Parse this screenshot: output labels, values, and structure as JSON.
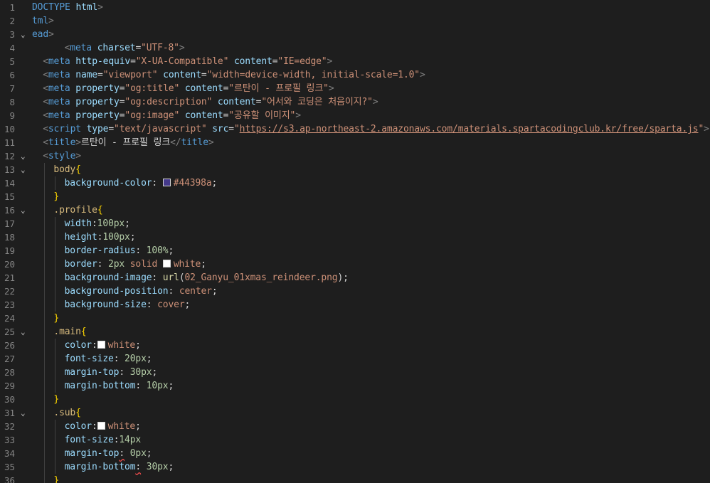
{
  "editor": {
    "lines": [
      {
        "n": "1",
        "fold": "",
        "indent": 0,
        "tokens": [
          [
            "t-tag",
            "DOCTYPE"
          ],
          [
            "t-text",
            " "
          ],
          [
            "t-attr",
            "html"
          ],
          [
            "t-punc",
            ">"
          ]
        ]
      },
      {
        "n": "2",
        "fold": "",
        "indent": 0,
        "tokens": [
          [
            "t-tag",
            "tml"
          ],
          [
            "t-punc",
            ">"
          ]
        ]
      },
      {
        "n": "3",
        "fold": "v",
        "indent": 0,
        "tokens": [
          [
            "t-tag",
            "ead"
          ],
          [
            "t-punc",
            ">"
          ]
        ]
      },
      {
        "n": "4",
        "fold": "",
        "indent": 3,
        "tokens": [
          [
            "t-punc",
            "<"
          ],
          [
            "t-tag",
            "meta"
          ],
          [
            "t-text",
            " "
          ],
          [
            "t-attr",
            "charset"
          ],
          [
            "t-text",
            "="
          ],
          [
            "t-str",
            "\"UTF-8\""
          ],
          [
            "t-punc",
            ">"
          ]
        ]
      },
      {
        "n": "5",
        "fold": "",
        "indent": 1,
        "tokens": [
          [
            "t-punc",
            "<"
          ],
          [
            "t-tag",
            "meta"
          ],
          [
            "t-text",
            " "
          ],
          [
            "t-attr",
            "http-equiv"
          ],
          [
            "t-text",
            "="
          ],
          [
            "t-str",
            "\"X-UA-Compatible\""
          ],
          [
            "t-text",
            " "
          ],
          [
            "t-attr",
            "content"
          ],
          [
            "t-text",
            "="
          ],
          [
            "t-str",
            "\"IE=edge\""
          ],
          [
            "t-punc",
            ">"
          ]
        ]
      },
      {
        "n": "6",
        "fold": "",
        "indent": 1,
        "tokens": [
          [
            "t-punc",
            "<"
          ],
          [
            "t-tag",
            "meta"
          ],
          [
            "t-text",
            " "
          ],
          [
            "t-attr",
            "name"
          ],
          [
            "t-text",
            "="
          ],
          [
            "t-str",
            "\"viewport\""
          ],
          [
            "t-text",
            " "
          ],
          [
            "t-attr",
            "content"
          ],
          [
            "t-text",
            "="
          ],
          [
            "t-str",
            "\"width=device-width, initial-scale=1.0\""
          ],
          [
            "t-punc",
            ">"
          ]
        ]
      },
      {
        "n": "7",
        "fold": "",
        "indent": 1,
        "tokens": [
          [
            "t-punc",
            "<"
          ],
          [
            "t-tag",
            "meta"
          ],
          [
            "t-text",
            " "
          ],
          [
            "t-attr",
            "property"
          ],
          [
            "t-text",
            "="
          ],
          [
            "t-str",
            "\"og:title\""
          ],
          [
            "t-text",
            " "
          ],
          [
            "t-attr",
            "content"
          ],
          [
            "t-text",
            "="
          ],
          [
            "t-str",
            "\"르탄이 - 프로필 링크\""
          ],
          [
            "t-punc",
            ">"
          ]
        ]
      },
      {
        "n": "8",
        "fold": "",
        "indent": 1,
        "tokens": [
          [
            "t-punc",
            "<"
          ],
          [
            "t-tag",
            "meta"
          ],
          [
            "t-text",
            " "
          ],
          [
            "t-attr",
            "property"
          ],
          [
            "t-text",
            "="
          ],
          [
            "t-str",
            "\"og:description\""
          ],
          [
            "t-text",
            " "
          ],
          [
            "t-attr",
            "content"
          ],
          [
            "t-text",
            "="
          ],
          [
            "t-str",
            "\"어서와 코딩은 처음이지?\""
          ],
          [
            "t-punc",
            ">"
          ]
        ]
      },
      {
        "n": "9",
        "fold": "",
        "indent": 1,
        "tokens": [
          [
            "t-punc",
            "<"
          ],
          [
            "t-tag",
            "meta"
          ],
          [
            "t-text",
            " "
          ],
          [
            "t-attr",
            "property"
          ],
          [
            "t-text",
            "="
          ],
          [
            "t-str",
            "\"og:image\""
          ],
          [
            "t-text",
            " "
          ],
          [
            "t-attr",
            "content"
          ],
          [
            "t-text",
            "="
          ],
          [
            "t-str",
            "\"공유할 이미지\""
          ],
          [
            "t-punc",
            ">"
          ]
        ]
      },
      {
        "n": "10",
        "fold": "",
        "indent": 1,
        "tokens": [
          [
            "t-punc",
            "<"
          ],
          [
            "t-tag",
            "script"
          ],
          [
            "t-text",
            " "
          ],
          [
            "t-attr",
            "type"
          ],
          [
            "t-text",
            "="
          ],
          [
            "t-str",
            "\"text/javascript\""
          ],
          [
            "t-text",
            " "
          ],
          [
            "t-attr",
            "src"
          ],
          [
            "t-text",
            "="
          ],
          [
            "t-str",
            "\""
          ],
          [
            "t-str t-link",
            "https://s3.ap-northeast-2.amazonaws.com/materials.spartacodingclub.kr/free/sparta.js"
          ],
          [
            "t-str",
            "\""
          ],
          [
            "t-punc",
            ">"
          ]
        ]
      },
      {
        "n": "11",
        "fold": "",
        "indent": 1,
        "tokens": [
          [
            "t-punc",
            "<"
          ],
          [
            "t-tag",
            "title"
          ],
          [
            "t-punc",
            ">"
          ],
          [
            "t-text",
            "르탄이 - 프로필 링크"
          ],
          [
            "t-punc",
            "</"
          ],
          [
            "t-tag",
            "title"
          ],
          [
            "t-punc",
            ">"
          ]
        ]
      },
      {
        "n": "12",
        "fold": "v",
        "indent": 1,
        "tokens": [
          [
            "t-punc",
            "<"
          ],
          [
            "t-tag",
            "style"
          ],
          [
            "t-punc",
            ">"
          ]
        ]
      },
      {
        "n": "13",
        "fold": "v",
        "indent": 2,
        "tokens": [
          [
            "t-sel",
            "body"
          ],
          [
            "t-brace",
            "{"
          ]
        ]
      },
      {
        "n": "14",
        "fold": "",
        "indent": 3,
        "tokens": [
          [
            "t-prop",
            "background-color"
          ],
          [
            "t-text",
            ": "
          ],
          [
            "swatch",
            "#44398a"
          ],
          [
            "t-val",
            "#44398a"
          ],
          [
            "t-text",
            ";"
          ]
        ]
      },
      {
        "n": "15",
        "fold": "",
        "indent": 2,
        "tokens": [
          [
            "t-brace",
            "}"
          ]
        ]
      },
      {
        "n": "16",
        "fold": "v",
        "indent": 2,
        "tokens": [
          [
            "t-sel",
            ".profile"
          ],
          [
            "t-brace",
            "{"
          ]
        ]
      },
      {
        "n": "17",
        "fold": "",
        "indent": 3,
        "tokens": [
          [
            "t-prop",
            "width"
          ],
          [
            "t-text",
            ":"
          ],
          [
            "t-num",
            "100px"
          ],
          [
            "t-text",
            ";"
          ]
        ]
      },
      {
        "n": "18",
        "fold": "",
        "indent": 3,
        "tokens": [
          [
            "t-prop",
            "height"
          ],
          [
            "t-text",
            ":"
          ],
          [
            "t-num",
            "100px"
          ],
          [
            "t-text",
            ";"
          ]
        ]
      },
      {
        "n": "19",
        "fold": "",
        "indent": 3,
        "tokens": [
          [
            "t-prop",
            "border-radius"
          ],
          [
            "t-text",
            ": "
          ],
          [
            "t-num",
            "100%"
          ],
          [
            "t-text",
            ";"
          ]
        ]
      },
      {
        "n": "20",
        "fold": "",
        "indent": 3,
        "tokens": [
          [
            "t-prop",
            "border"
          ],
          [
            "t-text",
            ": "
          ],
          [
            "t-num",
            "2px"
          ],
          [
            "t-text",
            " "
          ],
          [
            "t-val",
            "solid"
          ],
          [
            "t-text",
            " "
          ],
          [
            "swatch",
            "#ffffff"
          ],
          [
            "t-val",
            "white"
          ],
          [
            "t-text",
            ";"
          ]
        ]
      },
      {
        "n": "21",
        "fold": "",
        "indent": 3,
        "tokens": [
          [
            "t-prop",
            "background-image"
          ],
          [
            "t-text",
            ": "
          ],
          [
            "t-ent",
            "url"
          ],
          [
            "t-text",
            "("
          ],
          [
            "t-val",
            "02_Ganyu_01xmas_reindeer.png"
          ],
          [
            "t-text",
            ");"
          ]
        ]
      },
      {
        "n": "22",
        "fold": "",
        "indent": 3,
        "tokens": [
          [
            "t-prop",
            "background-position"
          ],
          [
            "t-text",
            ": "
          ],
          [
            "t-val",
            "center"
          ],
          [
            "t-text",
            ";"
          ]
        ]
      },
      {
        "n": "23",
        "fold": "",
        "indent": 3,
        "tokens": [
          [
            "t-prop",
            "background-size"
          ],
          [
            "t-text",
            ": "
          ],
          [
            "t-val",
            "cover"
          ],
          [
            "t-text",
            ";"
          ]
        ]
      },
      {
        "n": "24",
        "fold": "",
        "indent": 2,
        "tokens": [
          [
            "t-brace",
            "}"
          ]
        ]
      },
      {
        "n": "25",
        "fold": "v",
        "indent": 2,
        "tokens": [
          [
            "t-sel",
            ".main"
          ],
          [
            "t-brace",
            "{"
          ]
        ]
      },
      {
        "n": "26",
        "fold": "",
        "indent": 3,
        "tokens": [
          [
            "t-prop",
            "color"
          ],
          [
            "t-text",
            ":"
          ],
          [
            "swatch",
            "#ffffff"
          ],
          [
            "t-val",
            "white"
          ],
          [
            "t-text",
            ";"
          ]
        ]
      },
      {
        "n": "27",
        "fold": "",
        "indent": 3,
        "tokens": [
          [
            "t-prop",
            "font-size"
          ],
          [
            "t-text",
            ": "
          ],
          [
            "t-num",
            "20px"
          ],
          [
            "t-text",
            ";"
          ]
        ]
      },
      {
        "n": "28",
        "fold": "",
        "indent": 3,
        "tokens": [
          [
            "t-prop",
            "margin-top"
          ],
          [
            "t-text",
            ": "
          ],
          [
            "t-num",
            "30px"
          ],
          [
            "t-text",
            ";"
          ]
        ]
      },
      {
        "n": "29",
        "fold": "",
        "indent": 3,
        "tokens": [
          [
            "t-prop",
            "margin-bottom"
          ],
          [
            "t-text",
            ": "
          ],
          [
            "t-num",
            "10px"
          ],
          [
            "t-text",
            ";"
          ]
        ]
      },
      {
        "n": "30",
        "fold": "",
        "indent": 2,
        "tokens": [
          [
            "t-brace",
            "}"
          ]
        ]
      },
      {
        "n": "31",
        "fold": "v",
        "indent": 2,
        "tokens": [
          [
            "t-sel",
            ".sub"
          ],
          [
            "t-brace",
            "{"
          ]
        ]
      },
      {
        "n": "32",
        "fold": "",
        "indent": 3,
        "tokens": [
          [
            "t-prop",
            "color"
          ],
          [
            "t-text",
            ":"
          ],
          [
            "swatch",
            "#ffffff"
          ],
          [
            "t-val",
            "white"
          ],
          [
            "t-text",
            ";"
          ]
        ]
      },
      {
        "n": "33",
        "fold": "",
        "indent": 3,
        "tokens": [
          [
            "t-prop",
            "font-size"
          ],
          [
            "t-text",
            ":"
          ],
          [
            "t-num",
            "14px"
          ]
        ]
      },
      {
        "n": "34",
        "fold": "",
        "indent": 3,
        "tokens": [
          [
            "t-prop",
            "margin-top"
          ],
          [
            "t-text squig",
            ":"
          ],
          [
            "t-text",
            " "
          ],
          [
            "t-num",
            "0px"
          ],
          [
            "t-text",
            ";"
          ]
        ]
      },
      {
        "n": "35",
        "fold": "",
        "indent": 3,
        "tokens": [
          [
            "t-prop",
            "margin-bottom"
          ],
          [
            "t-text squig",
            ":"
          ],
          [
            "t-text",
            " "
          ],
          [
            "t-num",
            "30px"
          ],
          [
            "t-text",
            ";"
          ]
        ]
      },
      {
        "n": "36",
        "fold": "",
        "indent": 2,
        "tokens": [
          [
            "t-brace",
            "}"
          ]
        ]
      }
    ]
  }
}
